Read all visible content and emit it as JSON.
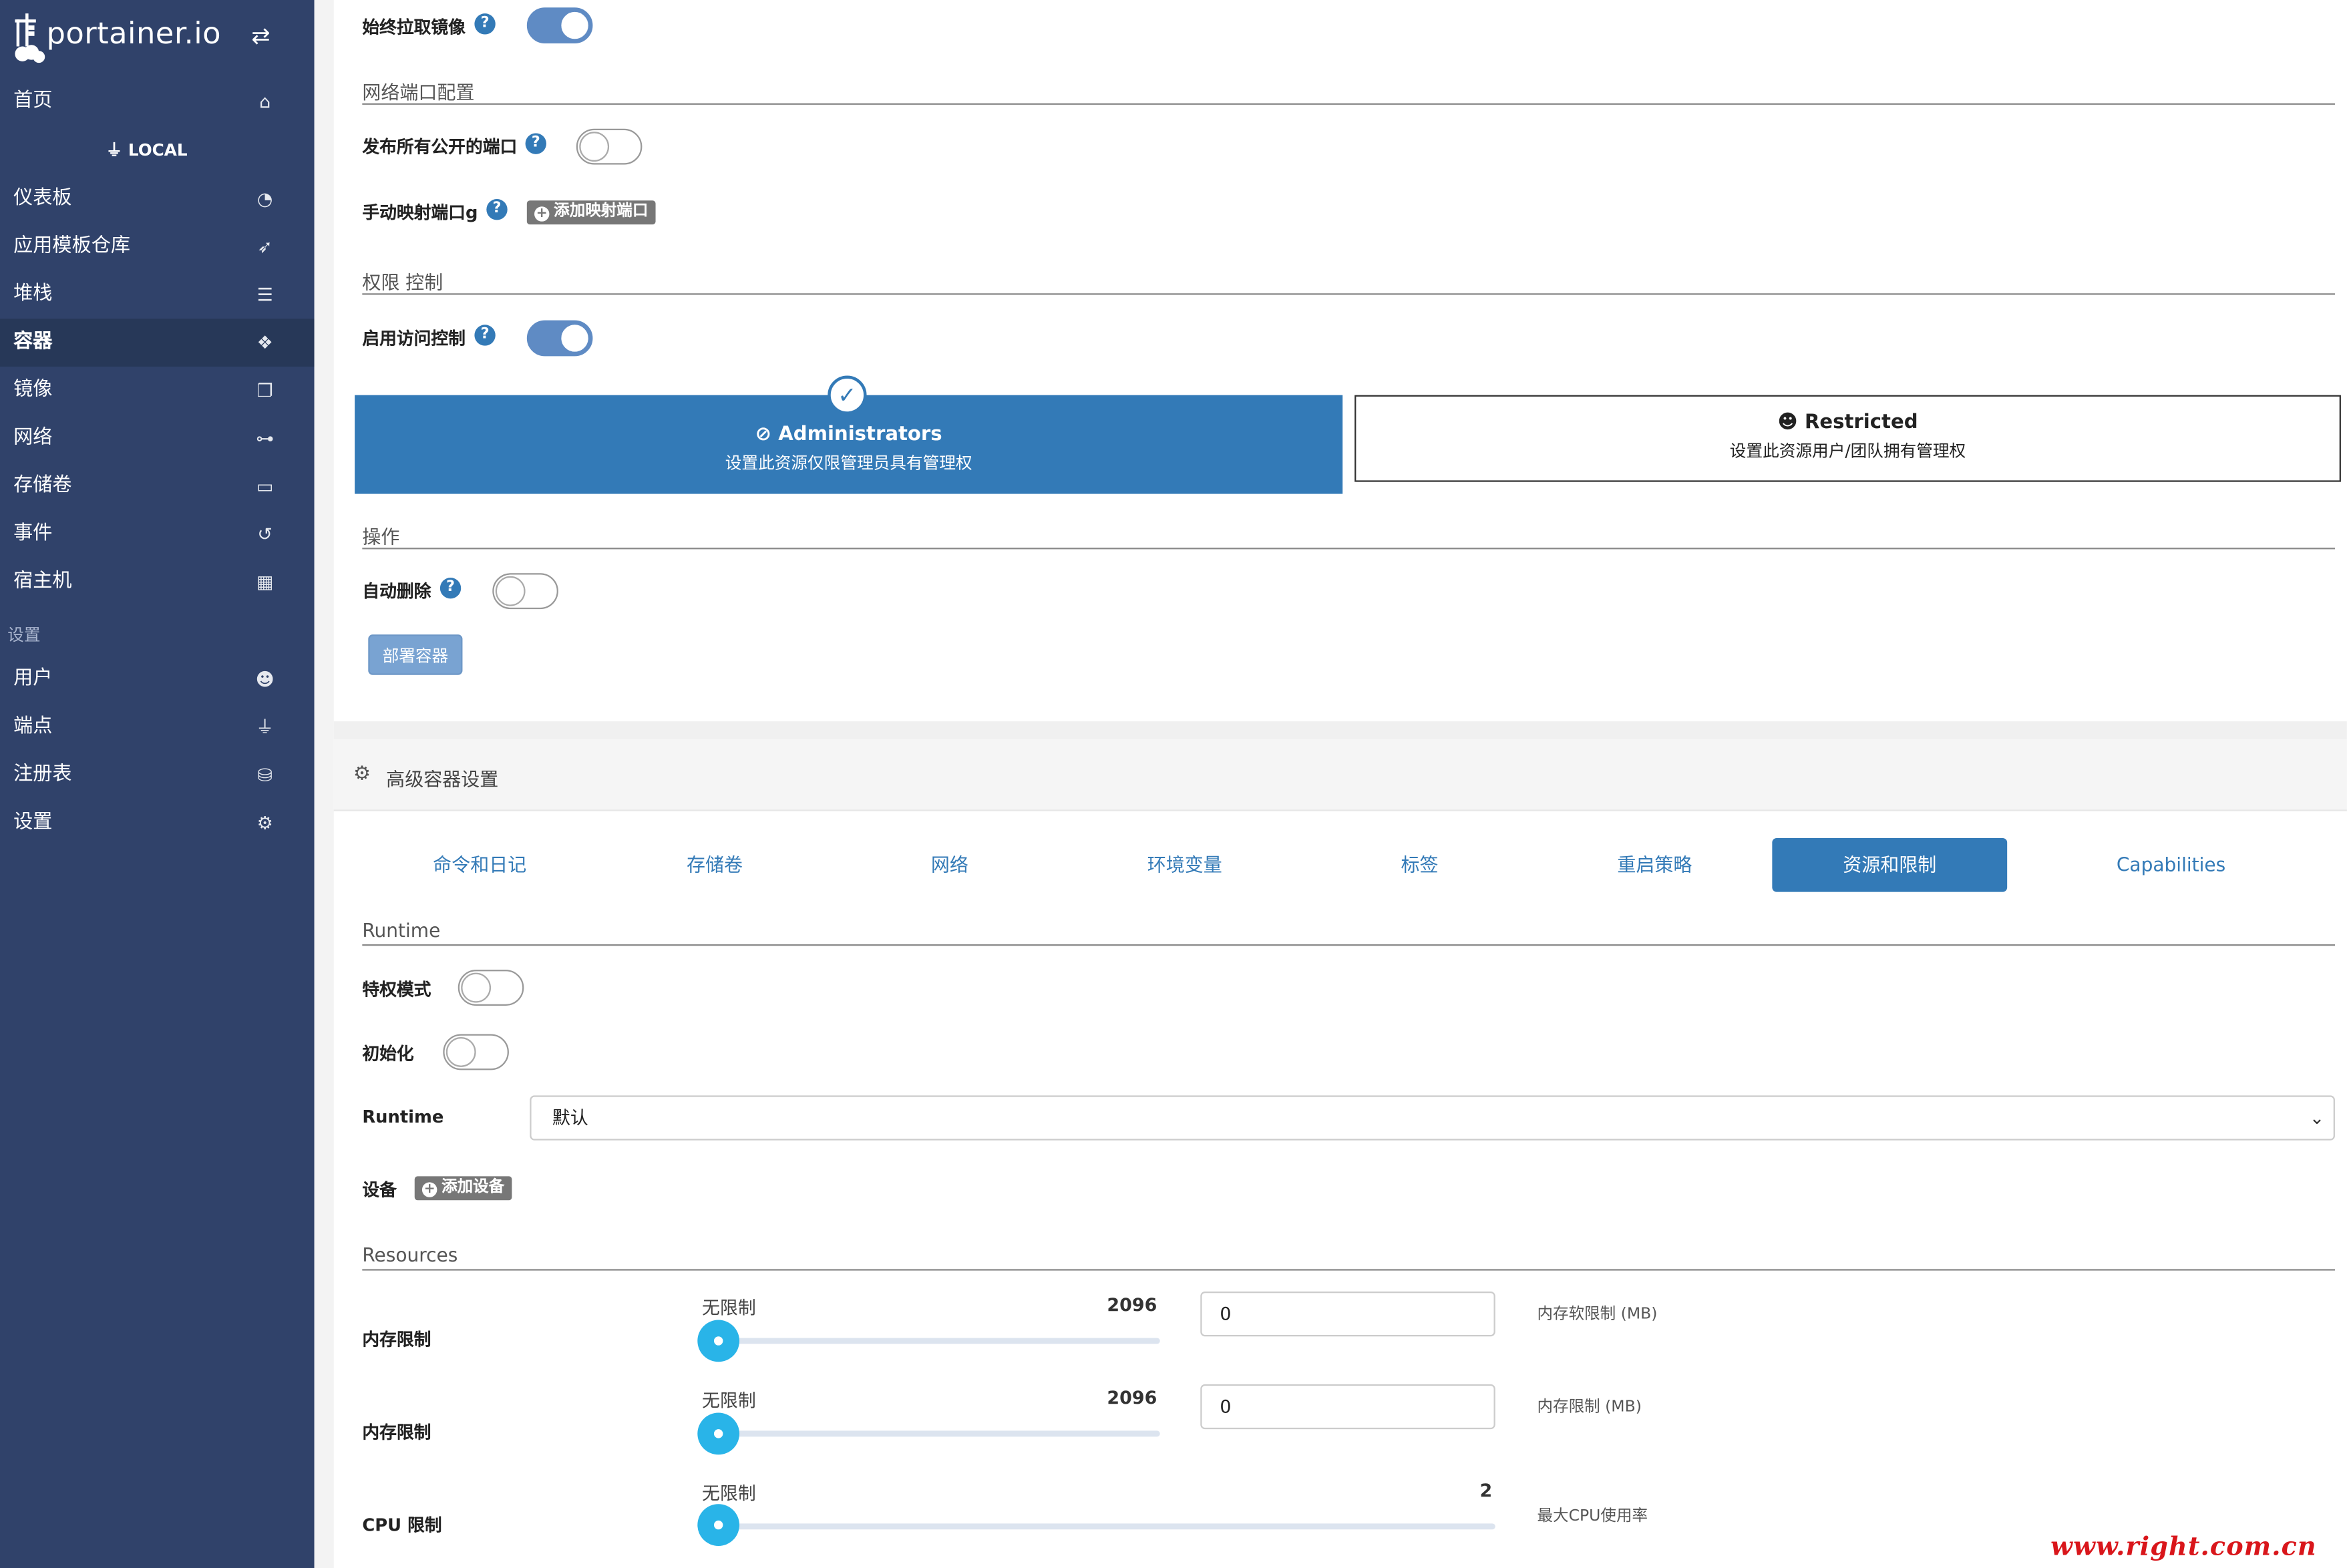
{
  "brand": {
    "name": "portainer.io"
  },
  "sidebar": {
    "home": "首页",
    "endpoint_label": "LOCAL",
    "items": [
      {
        "label": "仪表板",
        "icon": "dashboard-icon"
      },
      {
        "label": "应用模板仓库",
        "icon": "rocket-icon"
      },
      {
        "label": "堆栈",
        "icon": "list-icon"
      },
      {
        "label": "容器",
        "icon": "cubes-icon"
      },
      {
        "label": "镜像",
        "icon": "clone-icon"
      },
      {
        "label": "网络",
        "icon": "sitemap-icon"
      },
      {
        "label": "存储卷",
        "icon": "hdd-icon"
      },
      {
        "label": "事件",
        "icon": "history-icon"
      },
      {
        "label": "宿主机",
        "icon": "th-icon"
      }
    ],
    "settings_section": "设置",
    "settings_items": [
      {
        "label": "用户",
        "icon": "users-icon"
      },
      {
        "label": "端点",
        "icon": "plug-icon"
      },
      {
        "label": "注册表",
        "icon": "database-icon"
      },
      {
        "label": "设置",
        "icon": "cogs-icon"
      }
    ],
    "active_item": "容器"
  },
  "form": {
    "always_pull_label": "始终拉取镜像",
    "always_pull_on": true,
    "network_ports_title": "网络端口配置",
    "publish_all_label": "发布所有公开的端口",
    "publish_all_on": false,
    "manual_map_label": "手动映射端口g",
    "add_port_button": "添加映射端口",
    "access_control_title": "权限 控制",
    "enable_access_label": "启用访问控制",
    "enable_access_on": true,
    "admin_title": "Administrators",
    "admin_desc": "设置此资源仅限管理员具有管理权",
    "restricted_title": "Restricted",
    "restricted_desc": "设置此资源用户/团队拥有管理权",
    "actions_title": "操作",
    "auto_remove_label": "自动删除",
    "auto_remove_on": false,
    "deploy_button": "部署容器"
  },
  "advanced": {
    "title": "高级容器设置",
    "tabs": [
      "命令和日记",
      "存储卷",
      "网络",
      "环境变量",
      "标签",
      "重启策略",
      "资源和限制",
      "Capabilities"
    ],
    "active_tab": "资源和限制",
    "runtime_title": "Runtime",
    "privileged_label": "特权模式",
    "privileged_on": false,
    "init_label": "初始化",
    "init_on": false,
    "runtime_label": "Runtime",
    "runtime_value": "默认",
    "devices_label": "设备",
    "add_device_button": "添加设备",
    "resources_title": "Resources",
    "sliders": [
      {
        "label": "内存限制",
        "min_text": "无限制",
        "max_text": "2096",
        "value": 0,
        "input": "0",
        "hint": "内存软限制 (MB)"
      },
      {
        "label": "内存限制",
        "min_text": "无限制",
        "max_text": "2096",
        "value": 0,
        "input": "0",
        "hint": "内存限制 (MB)"
      },
      {
        "label": "CPU 限制",
        "min_text": "无限制",
        "max_text": "2",
        "value": 0,
        "hint": "最大CPU使用率"
      }
    ]
  },
  "watermark": "www.right.com.cn",
  "colors": {
    "sidebar": "#30426a",
    "primary": "#337ab7",
    "slider": "#29b4e8"
  }
}
